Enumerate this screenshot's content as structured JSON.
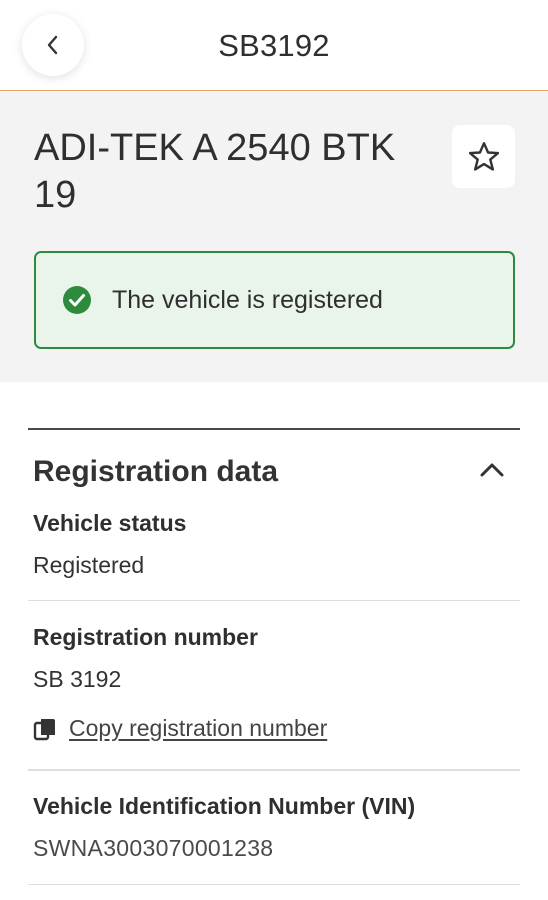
{
  "topbar": {
    "back_icon": "chevron-left-icon",
    "title": "SB3192"
  },
  "header": {
    "vehicle_title": "ADI-TEK A 2540 BTK 19",
    "favorite_icon": "star-outline-icon",
    "status": {
      "icon": "check-circle-icon",
      "text": "The vehicle is registered",
      "color": "#2e8b3e",
      "background": "#e9f4ea"
    }
  },
  "registration": {
    "section_title": "Registration data",
    "expanded": true,
    "chevron_icon": "chevron-up-icon",
    "fields": {
      "status": {
        "label": "Vehicle status",
        "value": "Registered"
      },
      "reg_number": {
        "label": "Registration number",
        "value": "SB 3192",
        "copy_label": "Copy registration number",
        "copy_icon": "copy-icon"
      },
      "vin": {
        "label": "Vehicle Identification Number (VIN)",
        "value": "SWNA3003070001238"
      }
    }
  },
  "colors": {
    "accent_line": "#e8a060",
    "header_background": "#f3f3f3",
    "success": "#2e8b3e"
  }
}
